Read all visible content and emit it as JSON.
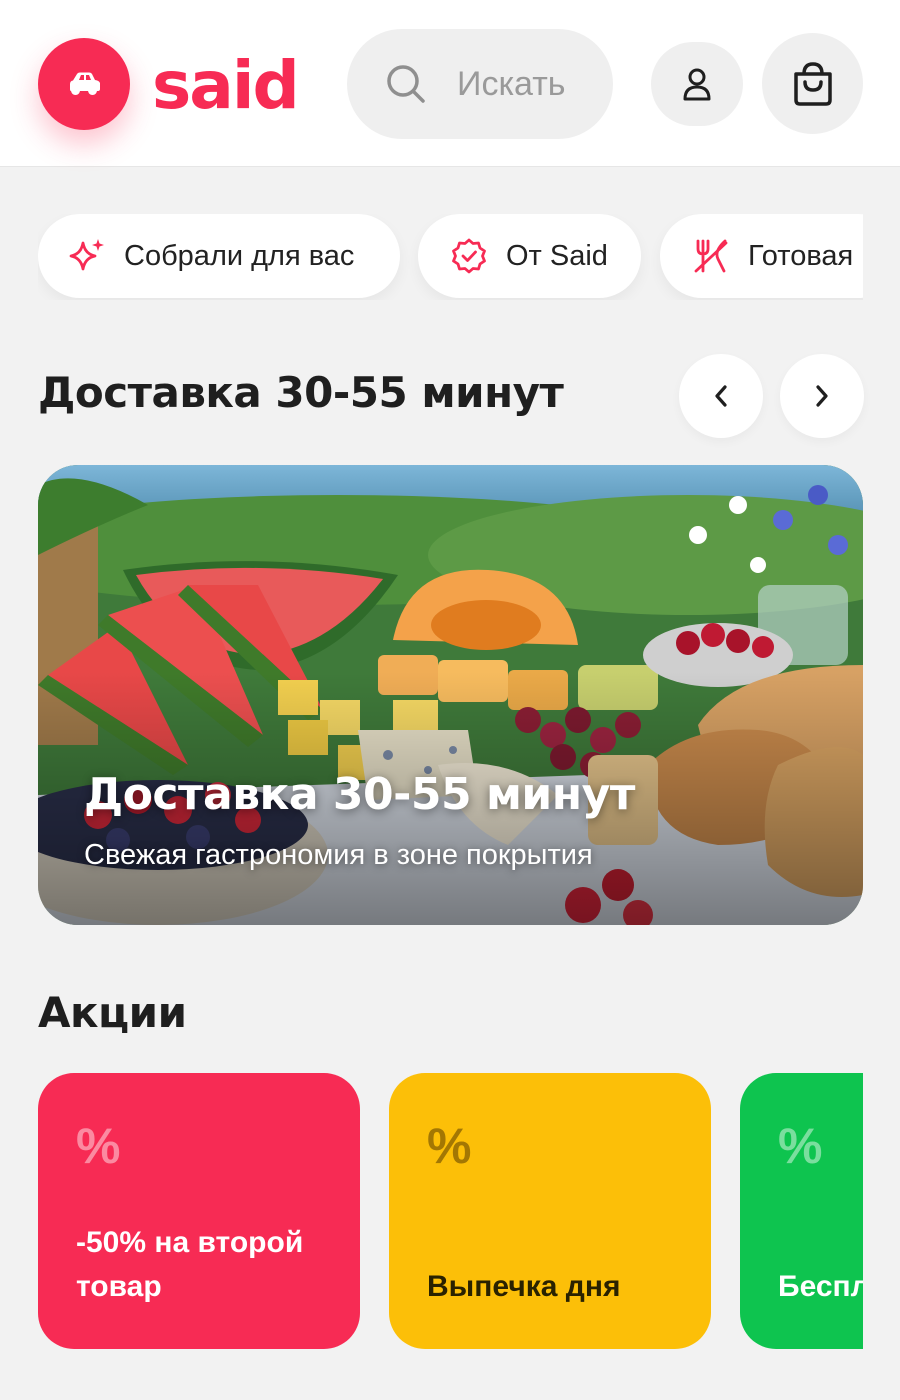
{
  "header": {
    "logo_icon": "car-icon",
    "logo_text": "said",
    "search_placeholder": "Искать",
    "profile_icon": "user-icon",
    "cart_icon": "shopping-bag-icon"
  },
  "categories": [
    {
      "label": "Собрали для вас",
      "icon": "sparkles-icon"
    },
    {
      "label": "От Said",
      "icon": "verified-badge-icon"
    },
    {
      "label": "Готовая",
      "icon": "fork-knife-icon"
    }
  ],
  "delivery_section": {
    "title": "Доставка 30-55 минут",
    "prev_icon": "chevron-left-icon",
    "next_icon": "chevron-right-icon"
  },
  "banner": {
    "title": "Доставка 30-55 минут",
    "subtitle": "Свежая гастрономия в зоне покрытия"
  },
  "promotions": {
    "title": "Акции",
    "cards": [
      {
        "symbol": "%",
        "text": "-50% на второй товар",
        "color": "#f72b54"
      },
      {
        "symbol": "%",
        "text": "Выпечка дня",
        "color": "#fcbf08"
      },
      {
        "symbol": "%",
        "text": "Бесплатная доставка",
        "color": "#0ec44f"
      }
    ]
  },
  "colors": {
    "brand": "#f72b54",
    "background": "#f2f2f2",
    "yellow": "#fcbf08",
    "green": "#0ec44f"
  }
}
